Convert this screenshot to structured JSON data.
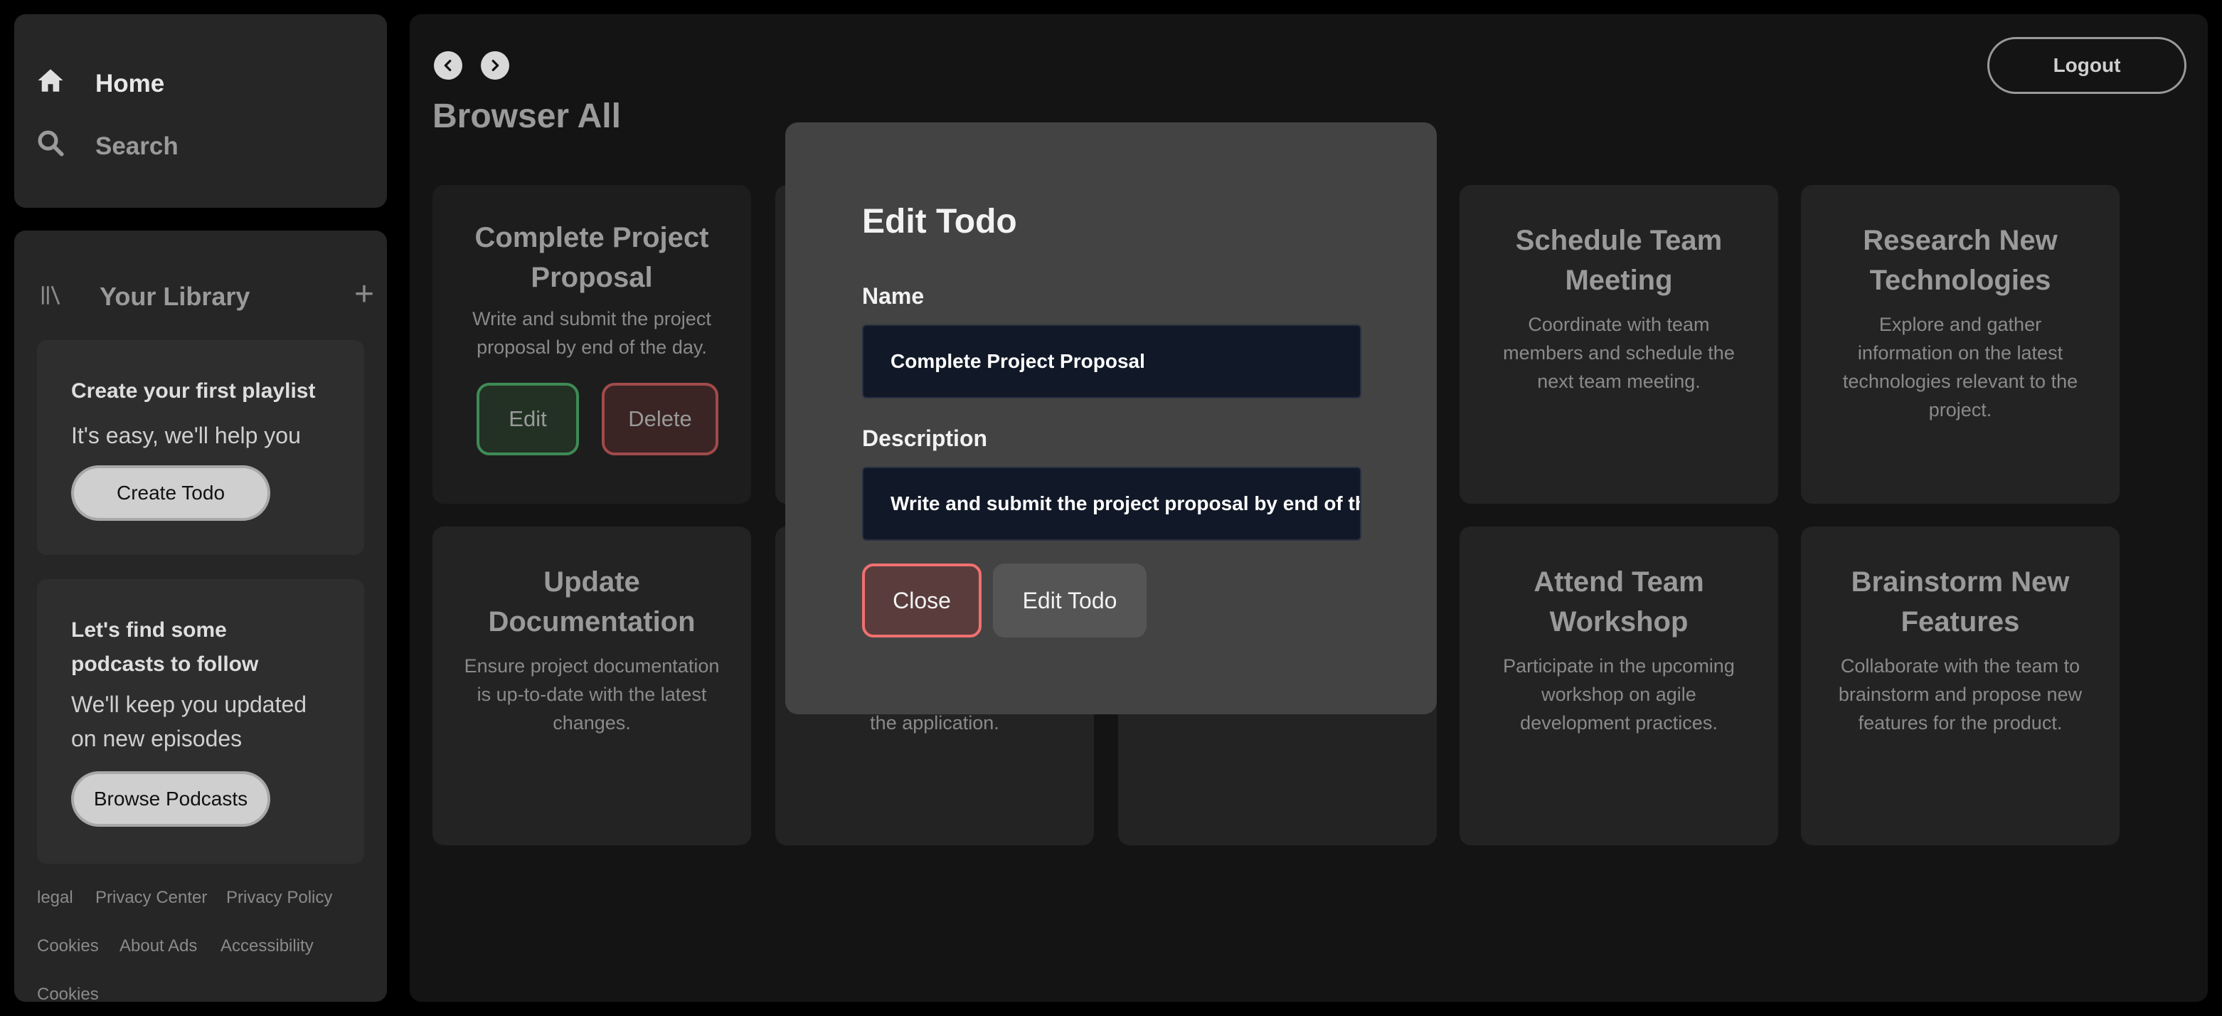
{
  "nav": {
    "home_label": "Home",
    "search_label": "Search"
  },
  "library": {
    "label": "Your Library",
    "add_icon": "+",
    "playlist_card": {
      "title": "Create your first playlist",
      "subtitle": "It's easy, we'll help you",
      "button": "Create Todo"
    },
    "podcast_card": {
      "title_line1": "Let's find some",
      "title_line2": "podcasts to follow",
      "subtitle_line1": "We'll keep you updated",
      "subtitle_line2": "on new episodes",
      "button": "Browse Podcasts"
    },
    "footer_links": [
      "legal",
      "Privacy Center",
      "Privacy Policy",
      "Cookies",
      "About Ads",
      "Accessibility",
      "Cookies"
    ]
  },
  "header": {
    "title": "Browser All",
    "logout": "Logout"
  },
  "todos": [
    {
      "title_line1": "Complete Project",
      "title_line2": "Proposal",
      "desc_line1": "Write and submit the project",
      "desc_line2": "proposal by end of the day.",
      "edit": "Edit",
      "delete": "Delete"
    },
    {
      "title_line1": "Schedule Team",
      "title_line2": "Meeting",
      "desc_line1": "Coordinate with team",
      "desc_line2": "members and schedule the",
      "desc_line3": "next team meeting."
    },
    {
      "title_line1": "Research New",
      "title_line2": "Technologies",
      "desc_line1": "Explore and gather",
      "desc_line2": "information on the latest",
      "desc_line3": "technologies relevant to the",
      "desc_line4": "project."
    },
    {
      "title_line1": "Update",
      "title_line2": "Documentation",
      "desc_line1": "Ensure project documentation",
      "desc_line2": "is up-to-date with the latest",
      "desc_line3": "changes."
    },
    {
      "desc_last": "the application."
    },
    {
      "title_line1": "Attend Team",
      "title_line2": "Workshop",
      "desc_line1": "Participate in the upcoming",
      "desc_line2": "workshop on agile",
      "desc_line3": "development practices."
    },
    {
      "title_line1": "Brainstorm New",
      "title_line2": "Features",
      "desc_line1": "Collaborate with the team to",
      "desc_line2": "brainstorm and propose new",
      "desc_line3": "features for the product."
    }
  ],
  "modal": {
    "title": "Edit Todo",
    "name_label": "Name",
    "name_value": "Complete Project Proposal",
    "description_label": "Description",
    "description_value": "Write and submit the project proposal by end of the day.",
    "close": "Close",
    "submit": "Edit Todo"
  },
  "colors": {
    "background": "#000000",
    "panel": "#262626",
    "main": "#141414",
    "modal": "#434343",
    "input": "#111827",
    "edit_border": "#3e8a55",
    "delete_border": "#a04a4a",
    "close_border": "#f07070"
  },
  "icons": {
    "home": "home-icon",
    "search": "search-icon",
    "library": "library-icon",
    "back": "chevron-left-icon",
    "forward": "chevron-right-icon"
  }
}
